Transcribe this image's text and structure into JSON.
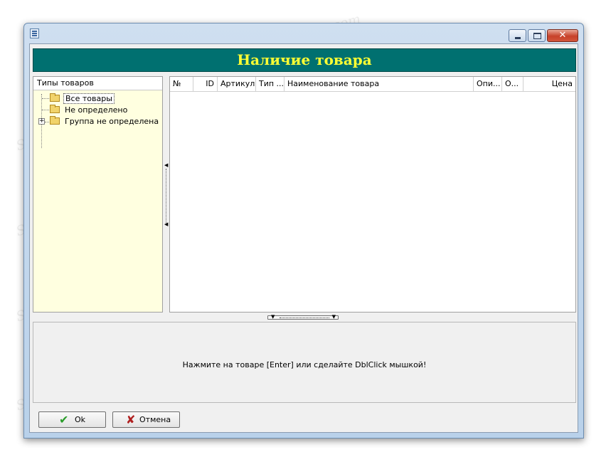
{
  "window": {
    "close_glyph": "✕",
    "header_title": "Наличие товара"
  },
  "tree": {
    "header": "Типы товаров",
    "items": [
      {
        "label": "Все товары",
        "selected": true
      },
      {
        "label": "Не определено",
        "selected": false
      },
      {
        "label": "Группа не определена",
        "selected": false,
        "expandable": true
      }
    ],
    "expander_glyph": "+"
  },
  "grid": {
    "columns": [
      "№",
      "ID",
      "Артикул",
      "Тип ...",
      "Наименование товара",
      "Опи...",
      "О...",
      "Цена"
    ],
    "rows": []
  },
  "info": {
    "message": "Нажмите на товаре [Enter] или сделайте DblClick мышкой!"
  },
  "buttons": {
    "ok_label": "Ok",
    "ok_icon": "✔",
    "cancel_label": "Отмена",
    "cancel_icon": "✘"
  },
  "watermark": "Soringpcrepair.com",
  "colors": {
    "banner": "#007070",
    "banner_text": "#ffff33",
    "tree_background": "#ffffe0"
  }
}
